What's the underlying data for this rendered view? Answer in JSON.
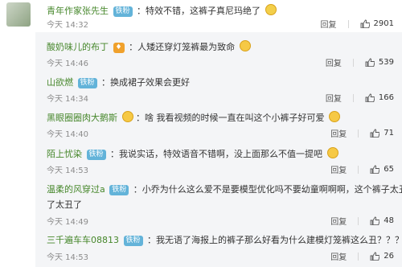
{
  "top_comment": {
    "username": "青年作家张先生",
    "badge": "铁粉",
    "text": "特效不错，这裤子真尼玛绝了",
    "time": "今天 14:32",
    "reply_label": "回复",
    "likes": "2901"
  },
  "replies": [
    {
      "username": "酸奶味儿的布丁",
      "badge": "",
      "text": "人矮还穿灯笼裤最为致命",
      "time": "今天 14:46",
      "reply_label": "回复",
      "likes": "539"
    },
    {
      "username": "山欲燃",
      "badge": "铁粉",
      "text": "换成裙子效果会更好",
      "time": "今天 14:34",
      "reply_label": "回复",
      "likes": "166"
    },
    {
      "username": "黑眼圈圈肉大鹅斯",
      "badge": "",
      "text": "啥 我看视频的时候一直在叫这个小裤子好可爱",
      "time": "今天 14:40",
      "reply_label": "回复",
      "likes": "71"
    },
    {
      "username": "陌上忧染",
      "badge": "铁粉",
      "text": "我说实话，特效语音不错啊，没上面那么不值一提吧",
      "time": "今天 14:53",
      "reply_label": "回复",
      "likes": "65"
    },
    {
      "username": "温柔的风穿过a",
      "badge": "铁粉",
      "text": "小乔为什么这么爱不是要模型优化吗不要幼童啊啊啊，这个裤子太丑",
      "text2": "了太丑了",
      "time": "今天 14:49",
      "reply_label": "回复",
      "likes": "48"
    },
    {
      "username": "三千遍车车08813",
      "badge": "铁粉",
      "text": "我无语了海报上的裤子那么好看为什么建模灯笼裤这么丑？？？",
      "time": "今天 14:53",
      "reply_label": "回复",
      "likes": "26"
    }
  ]
}
